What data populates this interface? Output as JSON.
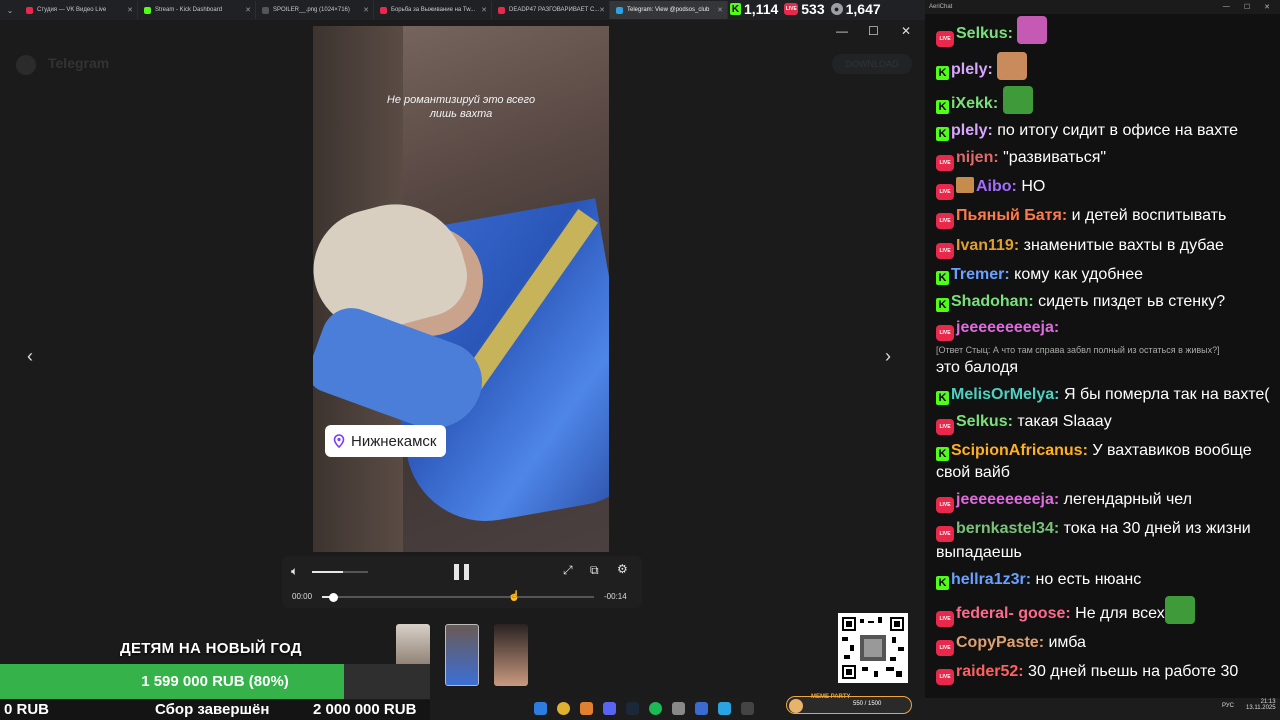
{
  "browser": {
    "tabs": [
      {
        "label": "Студия — VK Видео Live",
        "color": "#e8294b",
        "active": false
      },
      {
        "label": "Stream - Kick Dashboard",
        "color": "#53fc18",
        "active": false
      },
      {
        "label": "SPOILER__.png (1024×716)",
        "color": "#555555",
        "active": false
      },
      {
        "label": "Борьба за Выживание на Tw...",
        "color": "#e8294b",
        "active": false
      },
      {
        "label": "DEADP47 РАЗГОВАРИВАЕТ С...",
        "color": "#e8294b",
        "active": false
      },
      {
        "label": "Telegram: View @podsos_club",
        "color": "#2aa3e0",
        "active": true
      }
    ]
  },
  "stats": {
    "kick": "1,114",
    "vk": "533",
    "total": "1,647"
  },
  "telegram": {
    "title": "Telegram",
    "download": "DOWNLOAD"
  },
  "video": {
    "caption_line1": "Не романтизируй это всего",
    "caption_line2": "лишь вахта",
    "location": "Нижнекамск",
    "time_current": "00:00",
    "time_remaining": "-00:14",
    "progress": 0.04,
    "volume": 0.55,
    "hover_position": 0.7
  },
  "donation": {
    "title": "ДЕТЯМ НА НОВЫЙ ГОД",
    "collected": "1 599 000 RUB (80%)",
    "progress": 0.8,
    "start": "0 RUB",
    "status": "Сбор завершён",
    "goal": "2 000 000 RUB"
  },
  "meme_party": {
    "label": "MEME PARTY",
    "count": "550 / 1500"
  },
  "taskbar": {
    "lang": "РУС",
    "time": "21:13",
    "date": "13.11.2025"
  },
  "chat": {
    "app": "AeriChat",
    "messages": [
      {
        "platform": "live",
        "user": "Selkus",
        "color": "#7be07b",
        "text": "",
        "emote": "#c45ab3"
      },
      {
        "platform": "kick",
        "user": "plely",
        "color": "#d8a6ff",
        "text": "",
        "emote": "#c98a5c"
      },
      {
        "platform": "kick",
        "user": "iXekk",
        "color": "#7be07b",
        "text": "",
        "emote": "#3f9a3a"
      },
      {
        "platform": "kick",
        "user": "plely",
        "color": "#d8a6ff",
        "text": "по итогу сидит в офисе на вахте"
      },
      {
        "platform": "live",
        "user": "nijen",
        "color": "#e06a6a",
        "text": "\"развиваться\""
      },
      {
        "platform": "live",
        "user": "Aibo",
        "color": "#a56bff",
        "text": "НО",
        "gift": true
      },
      {
        "platform": "live",
        "user": "Пьяный Батя",
        "color": "#ff7a4a",
        "text": "и детей воспитывать"
      },
      {
        "platform": "live",
        "user": "Ivan119",
        "color": "#e0a030",
        "text": "знаменитые вахты в дубае"
      },
      {
        "platform": "kick",
        "user": "Tremer",
        "color": "#6aa0ff",
        "text": "кому как удобнее"
      },
      {
        "platform": "kick",
        "user": "Shadohan",
        "color": "#7be07b",
        "text": "сидеть пиздет ьв стенку?"
      },
      {
        "platform": "live",
        "user": "jeeeeeeeeeja",
        "color": "#e06adf",
        "text": "это балодя",
        "reply": "[Ответ Стыц: А что там справа забвл полный из остаться в живых?]"
      },
      {
        "platform": "kick",
        "user": "MelisOrMelya",
        "color": "#4fd0c0",
        "text": "Я бы померла так на вахте("
      },
      {
        "platform": "live",
        "user": "Selkus",
        "color": "#7be07b",
        "text": "такая Slaaay"
      },
      {
        "platform": "kick",
        "user": "ScipionAfricanus",
        "color": "#ffb020",
        "text": "У вахтавиков вообще свой вайб"
      },
      {
        "platform": "live",
        "user": "jeeeeeeeeeja",
        "color": "#e06adf",
        "text": "легендарный чел"
      },
      {
        "platform": "live",
        "user": "bernkastel34",
        "color": "#7bc07b",
        "text": "тока на 30 дней из жизни выпадаешь"
      },
      {
        "platform": "kick",
        "user": "hellra1z3r",
        "color": "#6aa0ff",
        "text": "но есть нюанс"
      },
      {
        "platform": "live",
        "user": "federal- goose",
        "color": "#ff6a8a",
        "text": "Не для всех",
        "emote": "#3f9a3a"
      },
      {
        "platform": "live",
        "user": "CopyPaste",
        "color": "#e0a070",
        "text": "имба"
      },
      {
        "platform": "live",
        "user": "raider52",
        "color": "#ff6060",
        "text": "30 дней пьешь на работе 30"
      }
    ]
  }
}
